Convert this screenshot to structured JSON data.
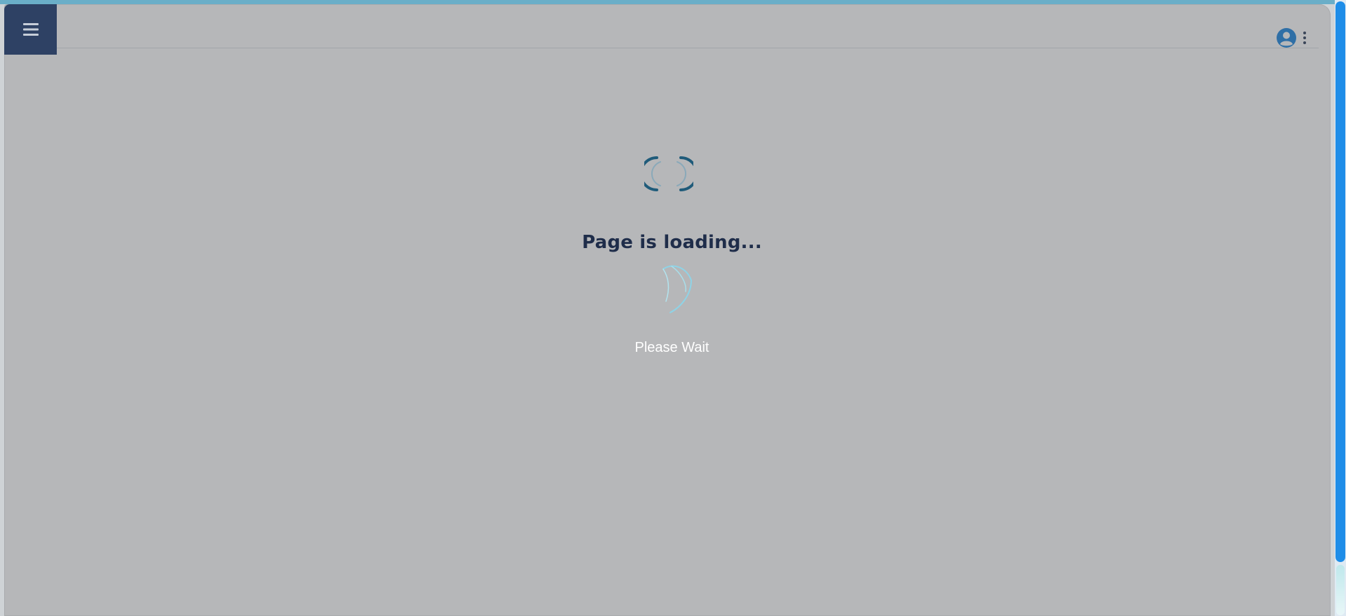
{
  "header": {
    "menu_icon": "hamburger-menu-icon",
    "user_icon": "user-circle-icon",
    "more_icon": "vertical-dots-icon"
  },
  "loader": {
    "title": "Page is loading...",
    "subtitle": "Please Wait"
  },
  "colors": {
    "menu_bg": "#2e4164",
    "overlay": "#b6b7b9",
    "title": "#1f2d4a",
    "spinner_dark": "#1f5b7a",
    "spinner_light": "#8fd3e6",
    "user_icon": "#2f6fa6",
    "scrollbar": "#1e8de8"
  }
}
